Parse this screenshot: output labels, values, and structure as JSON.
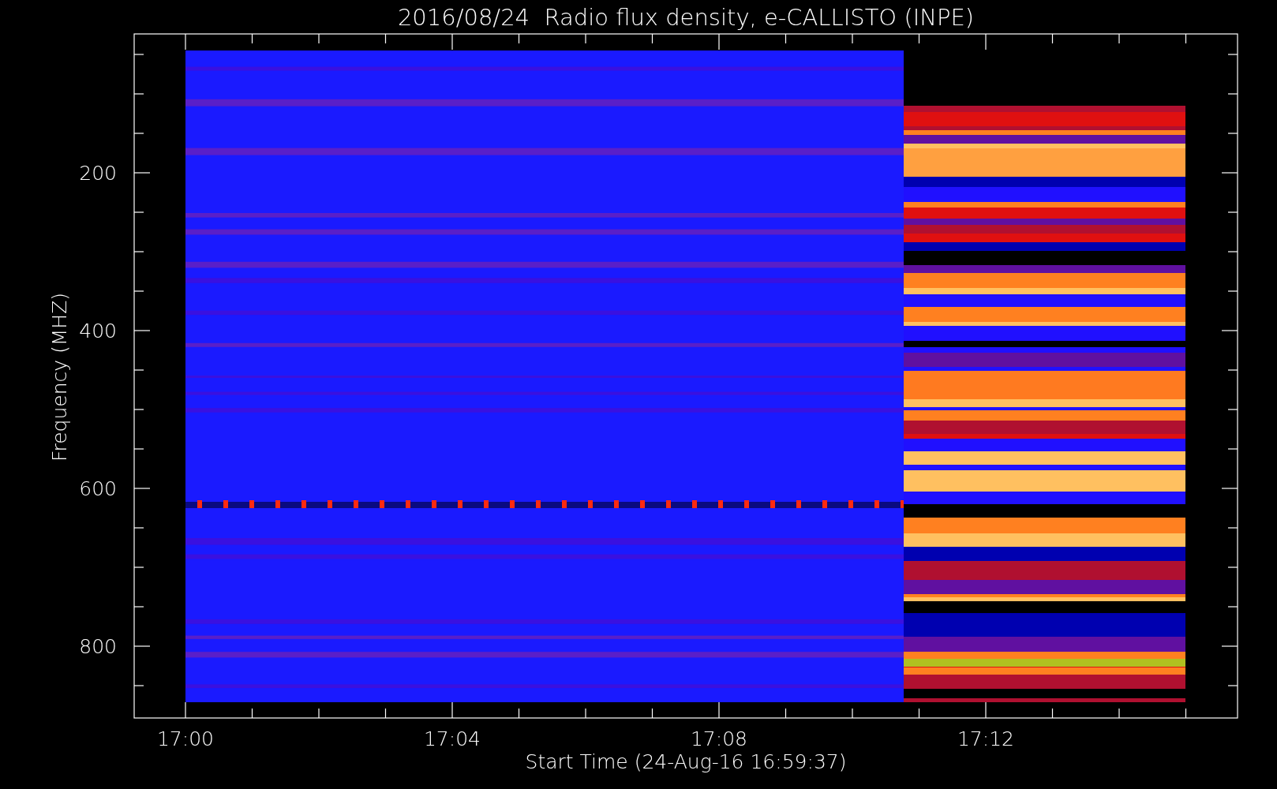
{
  "title": "2016/08/24  Radio flux density, e-CALLISTO (INPE)",
  "ylabel": "Frequency (MHZ)",
  "xlabel": "Start Time (24-Aug-16 16:59:37)",
  "yticks": [
    "200",
    "400",
    "600",
    "800"
  ],
  "xticks": [
    "17:00",
    "17:04",
    "17:08",
    "17:12"
  ]
}
